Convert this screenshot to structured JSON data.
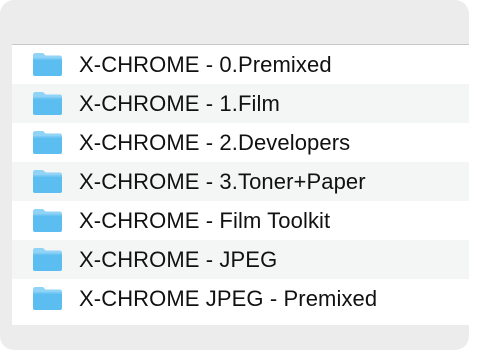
{
  "colors": {
    "folder_body": "#5cbdf0",
    "folder_tab": "#8fd3f6",
    "panel_background": "#ececec",
    "row_alt": "#f4f5f5"
  },
  "folders": [
    {
      "label": "X-CHROME - 0.Premixed",
      "icon": "folder-icon"
    },
    {
      "label": "X-CHROME - 1.Film",
      "icon": "folder-icon"
    },
    {
      "label": "X-CHROME - 2.Developers",
      "icon": "folder-icon"
    },
    {
      "label": "X-CHROME - 3.Toner+Paper",
      "icon": "folder-icon"
    },
    {
      "label": "X-CHROME - Film Toolkit",
      "icon": "folder-icon"
    },
    {
      "label": "X-CHROME - JPEG",
      "icon": "folder-icon"
    },
    {
      "label": "X-CHROME JPEG - Premixed",
      "icon": "folder-icon"
    }
  ]
}
